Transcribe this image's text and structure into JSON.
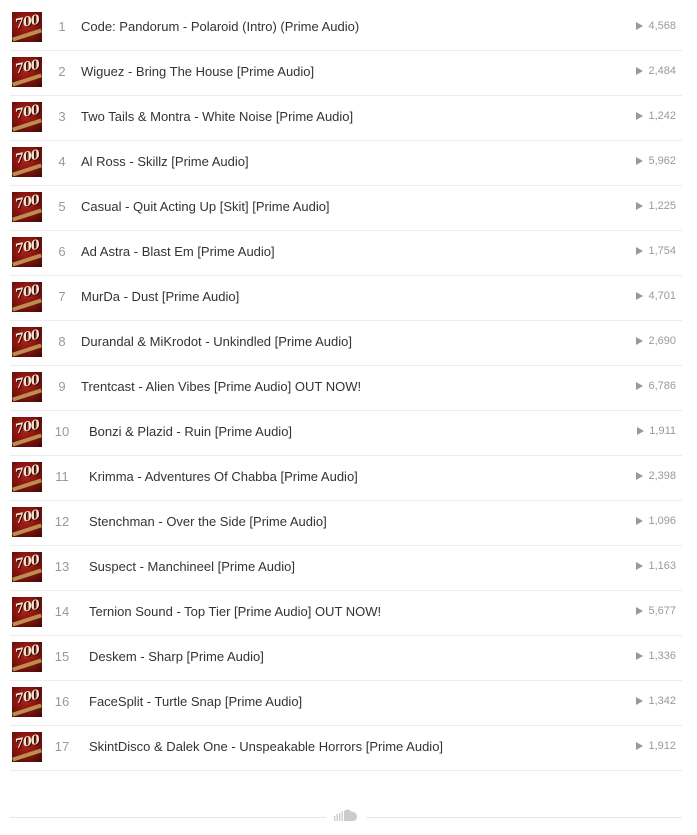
{
  "tracks": [
    {
      "num": "1",
      "title": "Code: Pandorum - Polaroid (Intro) (Prime Audio)",
      "plays": "4,568",
      "art": "700"
    },
    {
      "num": "2",
      "title": "Wiguez - Bring The House [Prime Audio]",
      "plays": "2,484",
      "art": "700"
    },
    {
      "num": "3",
      "title": "Two Tails & Montra - White Noise [Prime Audio]",
      "plays": "1,242",
      "art": "700"
    },
    {
      "num": "4",
      "title": "Al Ross - Skillz [Prime Audio]",
      "plays": "5,962",
      "art": "700"
    },
    {
      "num": "5",
      "title": "Casual - Quit Acting Up [Skit] [Prime Audio]",
      "plays": "1,225",
      "art": "700"
    },
    {
      "num": "6",
      "title": "Ad Astra - Blast Em [Prime Audio]",
      "plays": "1,754",
      "art": "700"
    },
    {
      "num": "7",
      "title": "MurDa - Dust [Prime Audio]",
      "plays": "4,701",
      "art": "700"
    },
    {
      "num": "8",
      "title": "Durandal & MiKrodot - Unkindled [Prime Audio]",
      "plays": "2,690",
      "art": "700"
    },
    {
      "num": "9",
      "title": "Trentcast - Alien Vibes [Prime Audio] OUT NOW!",
      "plays": "6,786",
      "art": "700"
    },
    {
      "num": "10",
      "title": "Bonzi & Plazid - Ruin [Prime Audio]",
      "plays": "1,911",
      "art": "700"
    },
    {
      "num": "11",
      "title": "Krimma - Adventures Of Chabba [Prime Audio]",
      "plays": "2,398",
      "art": "700"
    },
    {
      "num": "12",
      "title": "Stenchman - Over the Side [Prime Audio]",
      "plays": "1,096",
      "art": "700"
    },
    {
      "num": "13",
      "title": "Suspect - Manchineel [Prime Audio]",
      "plays": "1,163",
      "art": "700"
    },
    {
      "num": "14",
      "title": "Ternion Sound - Top Tier [Prime Audio] OUT NOW!",
      "plays": "5,677",
      "art": "700"
    },
    {
      "num": "15",
      "title": "Deskem - Sharp [Prime Audio]",
      "plays": "1,336",
      "art": "700"
    },
    {
      "num": "16",
      "title": "FaceSplit - Turtle Snap [Prime Audio]",
      "plays": "1,342",
      "art": "700"
    },
    {
      "num": "17",
      "title": "SkintDisco & Dalek One - Unspeakable Horrors [Prime Audio]",
      "plays": "1,912",
      "art": "700"
    }
  ],
  "icons": {
    "play": "play-icon",
    "footer": "soundcloud-icon"
  },
  "colors": {
    "text": "#333333",
    "muted": "#999999",
    "divider": "#ededed",
    "artwork": "#8a1510"
  }
}
